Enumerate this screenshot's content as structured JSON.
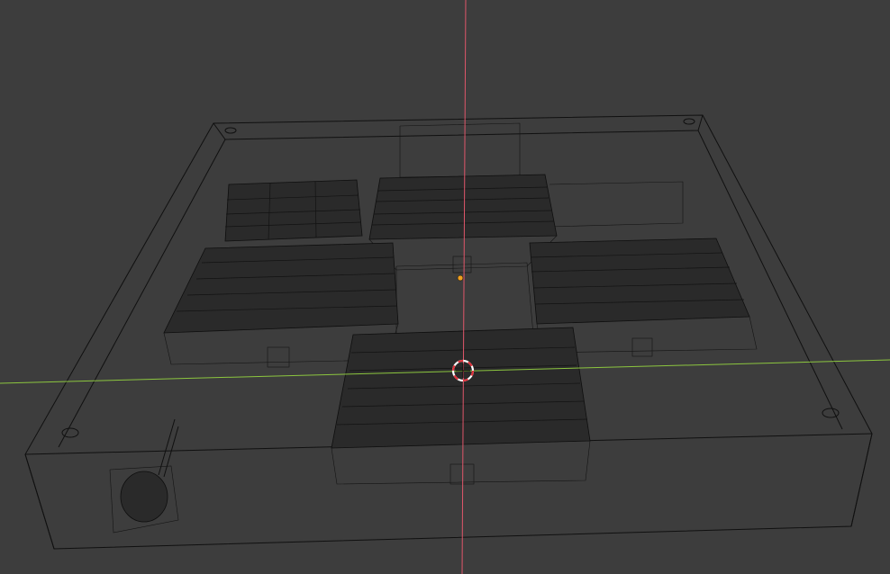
{
  "viewport": {
    "name": "3D Viewport",
    "shading": "wireframe",
    "colors": {
      "background": "#3d3d3d",
      "wire": "#101010",
      "axis_x": "#8cc63f",
      "axis_y": "#e0566a",
      "cursor_red": "#e0303a",
      "cursor_white": "#ffffff",
      "origin_dot": "#f0a020"
    }
  },
  "scene": {
    "objects": [
      {
        "kind": "base-frame",
        "icon": "box-wire"
      },
      {
        "kind": "building-north",
        "icon": "roof-wire"
      },
      {
        "kind": "building-west",
        "icon": "roof-wire"
      },
      {
        "kind": "building-east",
        "icon": "roof-wire"
      },
      {
        "kind": "building-south",
        "icon": "roof-wire"
      },
      {
        "kind": "small-complex-northwest",
        "icon": "mesh-wire"
      },
      {
        "kind": "ornament-southwest",
        "icon": "sphere-wire"
      }
    ]
  }
}
